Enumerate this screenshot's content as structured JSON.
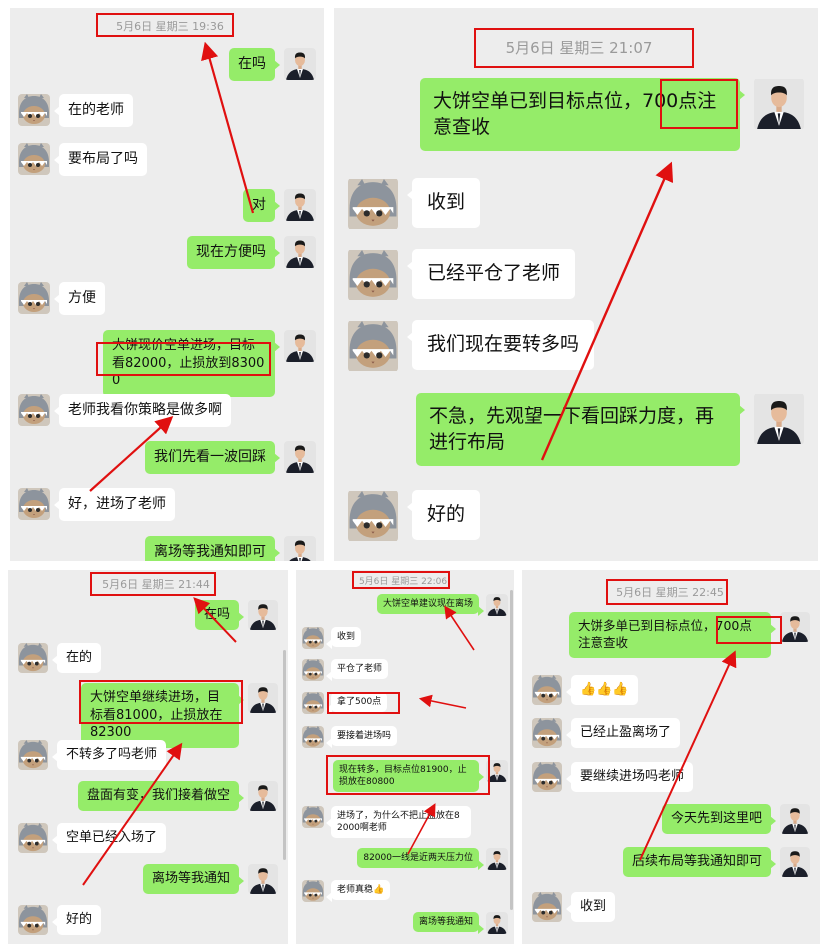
{
  "colors": {
    "background": "#ededed",
    "green_bubble": "#95ec69",
    "white_bubble": "#ffffff",
    "highlight": "#e01010",
    "timestamp": "#9a9a9a"
  },
  "icons": {
    "student_avatar": "cat-shark-avatar",
    "teacher_avatar": "teacher-avatar"
  },
  "chats": [
    {
      "timestamp": "5月6日 星期三 19:36",
      "messages": [
        {
          "side": "me",
          "text": "在吗"
        },
        {
          "side": "them",
          "text": "在的老师"
        },
        {
          "side": "them",
          "text": "要布局了吗"
        },
        {
          "side": "me",
          "text": "对"
        },
        {
          "side": "me",
          "text": "现在方便吗"
        },
        {
          "side": "them",
          "text": "方便"
        },
        {
          "side": "me",
          "text": "大饼现价空单进场，目标看82000，止损放到83000"
        },
        {
          "side": "them",
          "text": "老师我看你策略是做多啊"
        },
        {
          "side": "me",
          "text": "我们先看一波回踩"
        },
        {
          "side": "them",
          "text": "好，进场了老师"
        },
        {
          "side": "me",
          "text": "离场等我通知即可"
        }
      ]
    },
    {
      "timestamp": "5月6日 星期三 21:07",
      "messages": [
        {
          "side": "me",
          "text": "大饼空单已到目标点位，700点注意查收"
        },
        {
          "side": "them",
          "text": "收到"
        },
        {
          "side": "them",
          "text": "已经平仓了老师"
        },
        {
          "side": "them",
          "text": "我们现在要转多吗"
        },
        {
          "side": "me",
          "text": "不急，先观望一下看回踩力度，再进行布局"
        },
        {
          "side": "them",
          "text": "好的"
        }
      ]
    },
    {
      "timestamp": "5月6日 星期三 21:44",
      "messages": [
        {
          "side": "me",
          "text": "在吗"
        },
        {
          "side": "them",
          "text": "在的"
        },
        {
          "side": "me",
          "text": "大饼空单继续进场，目标看81000，止损放在82300"
        },
        {
          "side": "them",
          "text": "不转多了吗老师"
        },
        {
          "side": "me",
          "text": "盘面有变，我们接着做空"
        },
        {
          "side": "them",
          "text": "空单已经入场了"
        },
        {
          "side": "me",
          "text": "离场等我通知"
        },
        {
          "side": "them",
          "text": "好的"
        }
      ]
    },
    {
      "timestamp": "5月6日 星期三 22:06",
      "messages": [
        {
          "side": "me",
          "text": "大饼空单建议现在离场"
        },
        {
          "side": "them",
          "text": "收到"
        },
        {
          "side": "them",
          "text": "平仓了老师"
        },
        {
          "side": "them",
          "text": "拿了500点"
        },
        {
          "side": "them",
          "text": "要接着进场吗"
        },
        {
          "side": "me",
          "text": "现在转多，目标点位81900，止损放在80800"
        },
        {
          "side": "them",
          "text": "进场了，为什么不把止盈放在82000啊老师"
        },
        {
          "side": "me",
          "text": "82000一线是近两天压力位"
        },
        {
          "side": "them",
          "text": "老师真稳👍"
        },
        {
          "side": "me",
          "text": "离场等我通知"
        }
      ]
    },
    {
      "timestamp": "5月6日 星期三 22:45",
      "messages": [
        {
          "side": "me",
          "text": "大饼多单已到目标点位，700点注意查收"
        },
        {
          "side": "them",
          "text": "👍👍👍"
        },
        {
          "side": "them",
          "text": "已经止盈离场了"
        },
        {
          "side": "them",
          "text": "要继续进场吗老师"
        },
        {
          "side": "me",
          "text": "今天先到这里吧"
        },
        {
          "side": "me",
          "text": "后续布局等我通知即可"
        },
        {
          "side": "them",
          "text": "收到"
        }
      ]
    }
  ]
}
